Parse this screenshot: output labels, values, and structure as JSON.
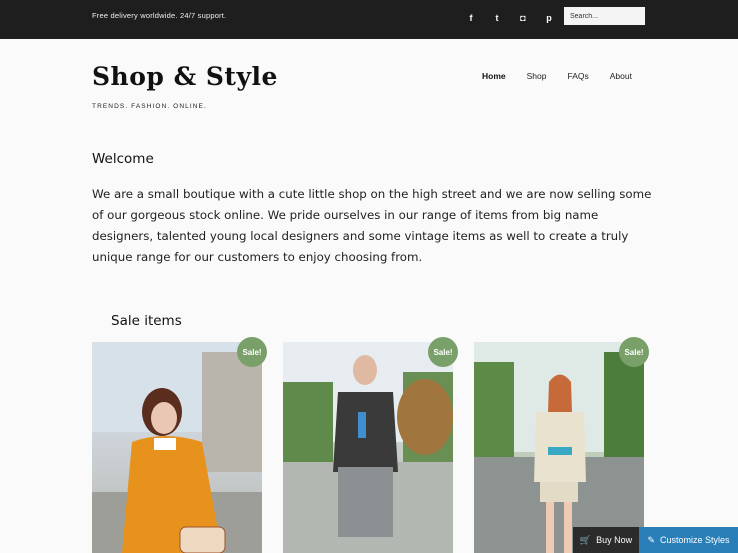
{
  "topbar": {
    "tagline": "Free delivery worldwide. 24/7 support.",
    "social_icons": [
      "facebook-icon",
      "twitter-icon",
      "instagram-icon",
      "pinterest-icon"
    ],
    "search_placeholder": "Search..."
  },
  "header": {
    "brand": "Shop & Style",
    "brand_tagline": "TRENDS. FASHION. ONLINE.",
    "nav": [
      "Home",
      "Shop",
      "FAQs",
      "About"
    ]
  },
  "main": {
    "welcome_title": "Welcome",
    "intro": "We are a small boutique with a cute little shop on the high street and we are now selling some of our gorgeous stock online. We pride ourselves in our range of items from big name designers, talented young local designers and some vintage items as well to create a truly unique range for our customers to enjoy choosing from.",
    "sale_title": "Sale items",
    "products": [
      {
        "badge": "Sale!"
      },
      {
        "badge": "Sale!"
      },
      {
        "badge": "Sale!"
      }
    ]
  },
  "footer_buttons": {
    "buy_now": "Buy Now",
    "customize": "Customize Styles"
  },
  "colors": {
    "topbar": "#1e1e1e",
    "badge": "#7aa06a",
    "customize": "#2a7fb8"
  }
}
